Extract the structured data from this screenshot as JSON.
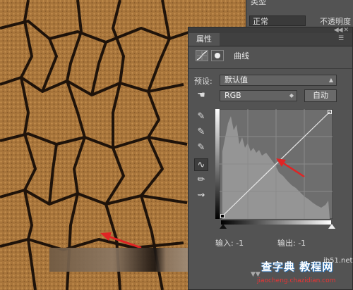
{
  "layers": {
    "partial_label": "类型",
    "blend_mode": "正常",
    "opacity_label": "不透明度"
  },
  "panel": {
    "tab": "属性",
    "title": "曲线",
    "preset_label": "预设:",
    "preset_value": "默认值",
    "channel": "RGB",
    "auto_button": "自动",
    "input_label": "输入: -1",
    "output_label": "输出: -1"
  },
  "watermark": {
    "brand": "查字典 教程网",
    "url": "jb51.net",
    "sub": "jiaocheng.chazidian.com"
  },
  "colors": {
    "panel_bg": "#535353",
    "arrow_red": "#e02424",
    "earth": "#a9763c"
  },
  "icons": [
    "curves-icon",
    "mask-icon",
    "hand-adjust-icon",
    "eyedropper-black-icon",
    "eyedropper-gray-icon",
    "eyedropper-white-icon",
    "curve-point-tool-icon",
    "pencil-icon",
    "smooth-icon"
  ]
}
